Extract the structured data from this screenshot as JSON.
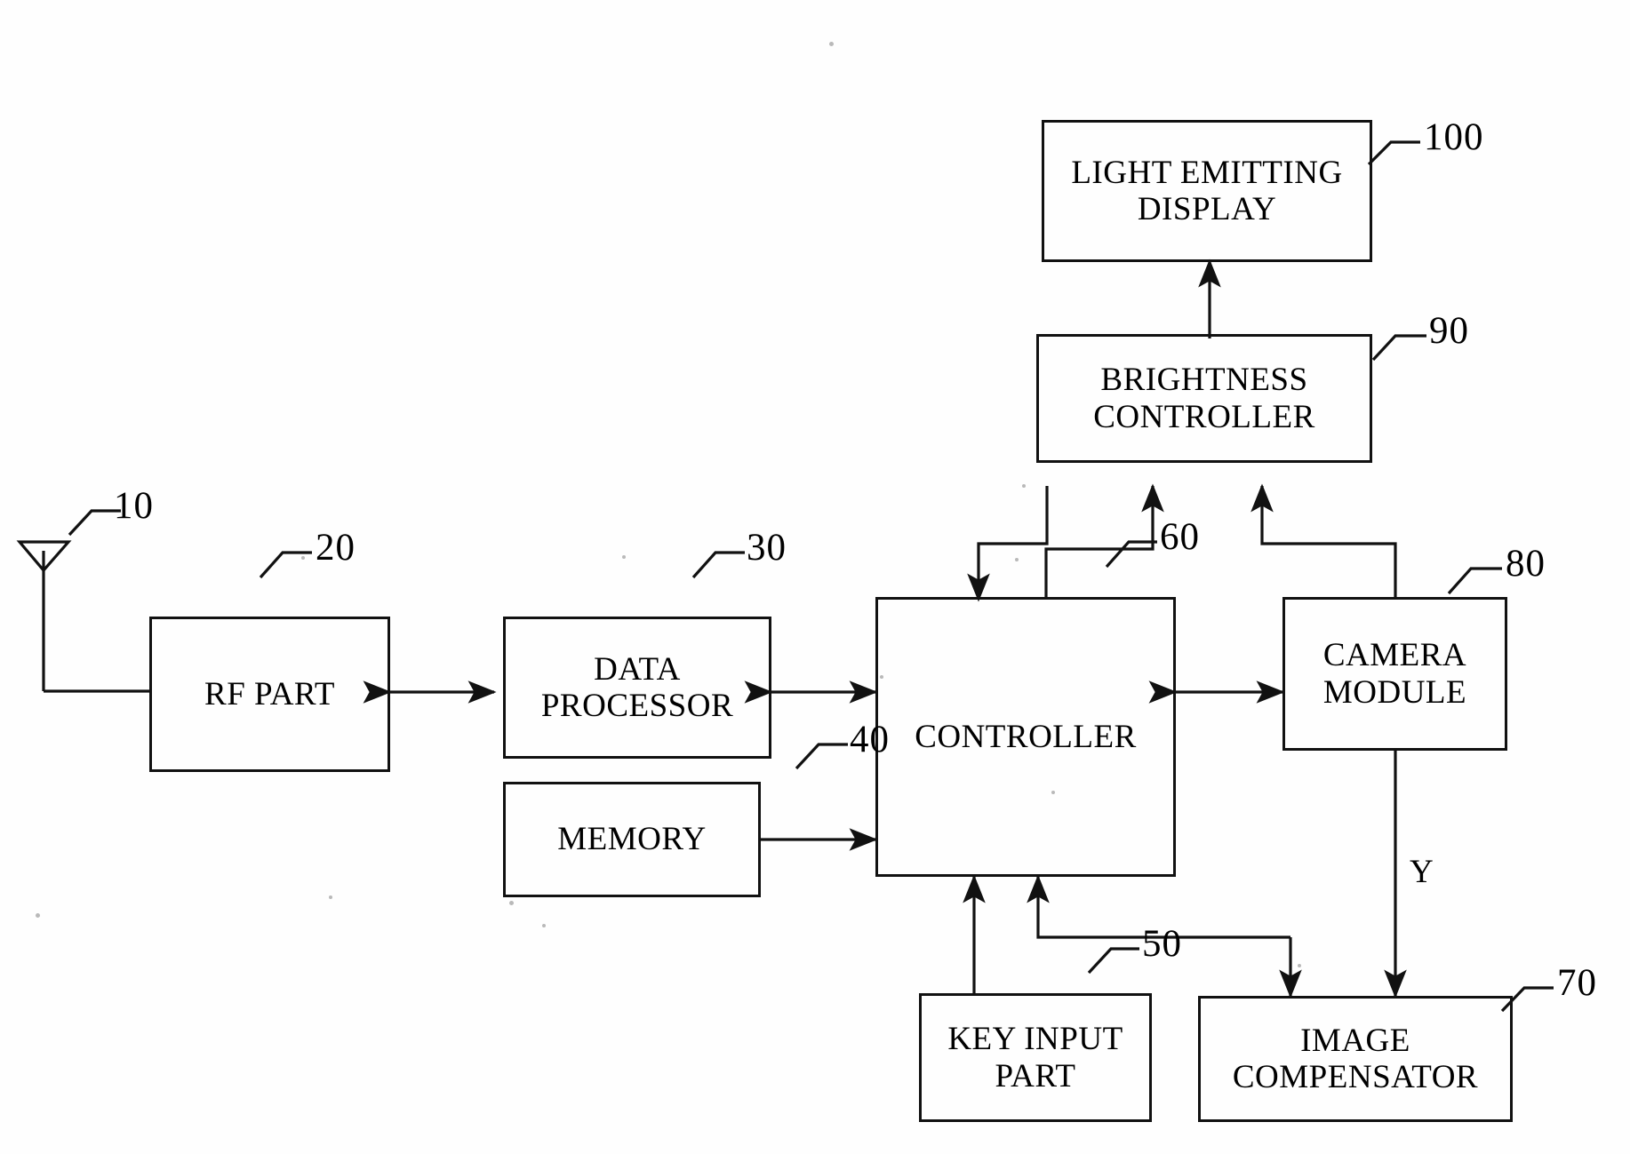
{
  "figure": {
    "type": "block-diagram",
    "title": "",
    "blocks": [
      {
        "id": "light_emitting_display",
        "label": "LIGHT EMITTING\nDISPLAY",
        "ref": "100"
      },
      {
        "id": "brightness_controller",
        "label": "BRIGHTNESS\nCONTROLLER",
        "ref": "90"
      },
      {
        "id": "rf_part",
        "label": "RF PART",
        "ref": "20"
      },
      {
        "id": "data_processor",
        "label": "DATA\nPROCESSOR",
        "ref": "30"
      },
      {
        "id": "memory",
        "label": "MEMORY",
        "ref": "40"
      },
      {
        "id": "controller",
        "label": "CONTROLLER",
        "ref": "60"
      },
      {
        "id": "camera_module",
        "label": "CAMERA\nMODULE",
        "ref": "80"
      },
      {
        "id": "key_input_part",
        "label": "KEY INPUT\nPART",
        "ref": "50"
      },
      {
        "id": "image_compensator",
        "label": "IMAGE\nCOMPENSATOR",
        "ref": "70"
      }
    ],
    "antenna": {
      "ref": "10"
    },
    "signals": [
      {
        "name": "luminance-signal",
        "label": "Y"
      }
    ],
    "refs": {
      "antenna": "10",
      "rf_part": "20",
      "data_processor": "30",
      "memory": "40",
      "key_input_part": "50",
      "controller": "60",
      "image_compensator": "70",
      "camera_module": "80",
      "brightness_controller": "90",
      "light_emitting_display": "100"
    },
    "colors": {
      "line": "#111111",
      "background": "#fefefe",
      "text": "#000000"
    }
  }
}
